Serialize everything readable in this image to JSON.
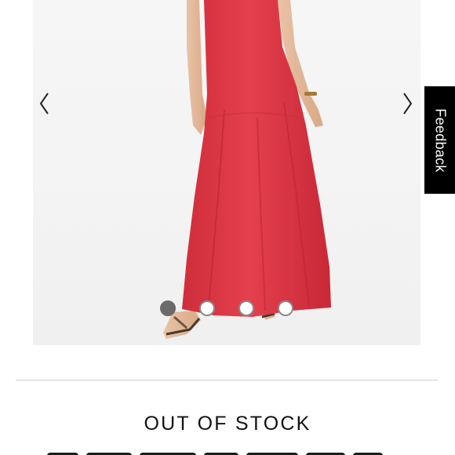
{
  "product_gallery": {
    "prev_icon": "chevron-left-icon",
    "next_icon": "chevron-right-icon",
    "slide_count": 4,
    "active_slide": 1
  },
  "feedback_tab": {
    "label": "Feedback"
  },
  "product": {
    "stock_status": "OUT OF STOCK"
  },
  "colors": {
    "dress": "#e23a48",
    "feedback_bg": "#000000",
    "active_dot": "#6b6b6b"
  }
}
